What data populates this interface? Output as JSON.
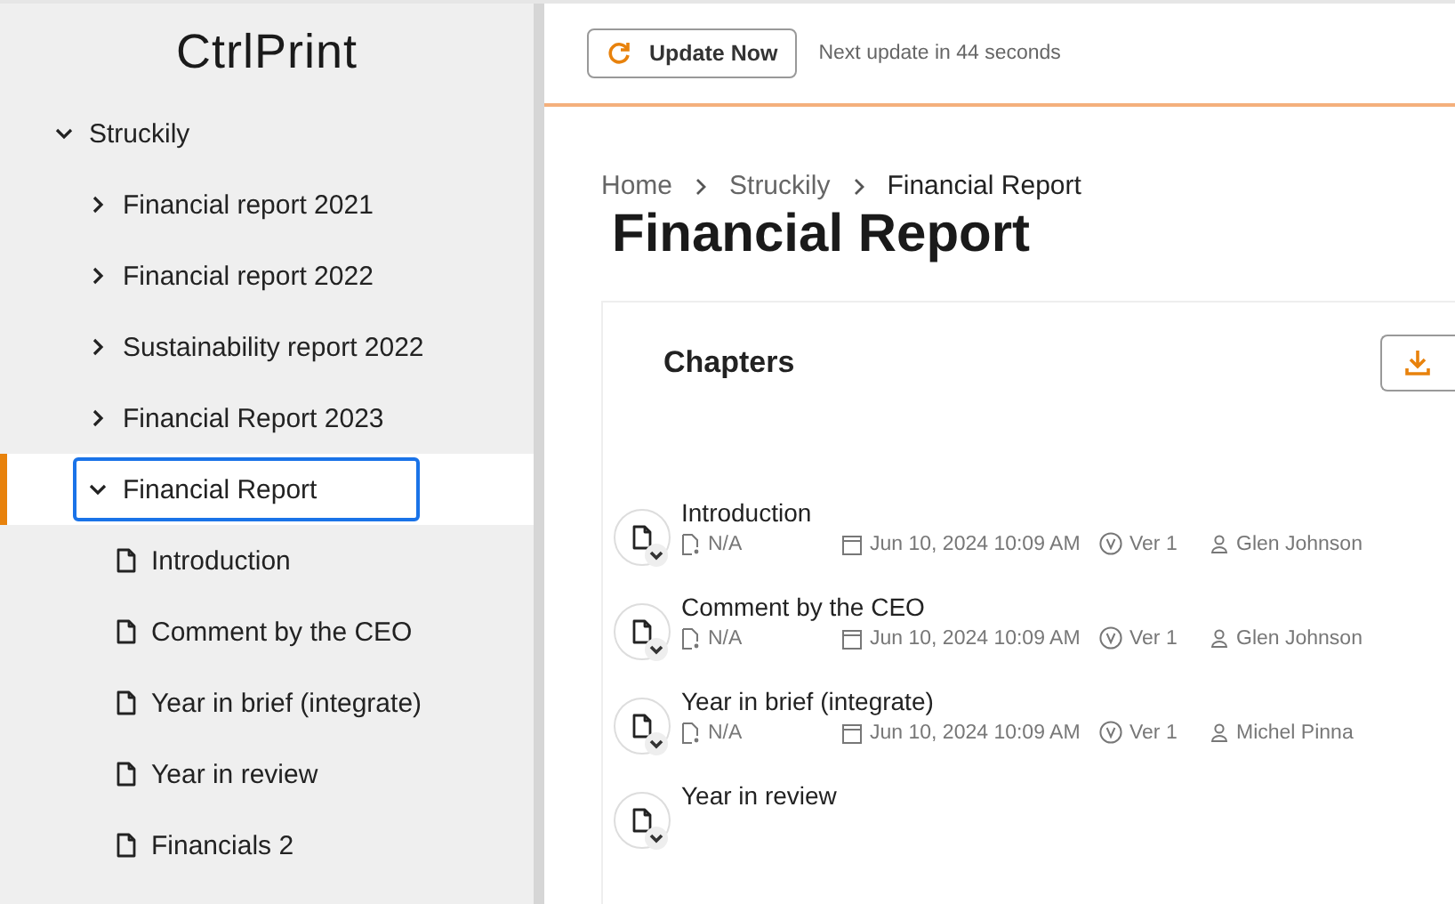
{
  "logo": "CtrlPrint",
  "tree": [
    {
      "label": "Struckily",
      "kind": "folder",
      "expanded": true,
      "selected": false,
      "children": [
        {
          "label": "Financial report 2021",
          "kind": "folder",
          "expanded": false,
          "selected": false
        },
        {
          "label": "Financial report 2022",
          "kind": "folder",
          "expanded": false,
          "selected": false
        },
        {
          "label": "Sustainability report 2022",
          "kind": "folder",
          "expanded": false,
          "selected": false
        },
        {
          "label": "Financial Report 2023",
          "kind": "folder",
          "expanded": false,
          "selected": false
        },
        {
          "label": "Financial Report",
          "kind": "folder",
          "expanded": true,
          "selected": true,
          "children": [
            {
              "label": "Introduction",
              "kind": "document",
              "selected": false
            },
            {
              "label": "Comment by the CEO",
              "kind": "document",
              "selected": false
            },
            {
              "label": "Year in brief (integrate)",
              "kind": "document",
              "selected": false
            },
            {
              "label": "Year in review",
              "kind": "document",
              "selected": false
            },
            {
              "label": "Financials 2",
              "kind": "document",
              "selected": false
            }
          ]
        }
      ]
    }
  ],
  "topbar": {
    "update_button": "Update Now",
    "next_update": "Next update in 44 seconds"
  },
  "breadcrumb": [
    "Home",
    "Struckily",
    "Financial Report"
  ],
  "page_title": "Financial Report",
  "chapters": {
    "title": "Chapters",
    "rows": [
      {
        "title": "Introduction",
        "status": "N/A",
        "date": "Jun 10, 2024 10:09 AM",
        "version": "Ver 1",
        "user": "Glen Johnson"
      },
      {
        "title": "Comment by the CEO",
        "status": "N/A",
        "date": "Jun 10, 2024 10:09 AM",
        "version": "Ver 1",
        "user": "Glen Johnson"
      },
      {
        "title": "Year in brief (integrate)",
        "status": "N/A",
        "date": "Jun 10, 2024 10:09 AM",
        "version": "Ver 1",
        "user": "Michel Pinna"
      },
      {
        "title": "Year in review"
      }
    ]
  }
}
